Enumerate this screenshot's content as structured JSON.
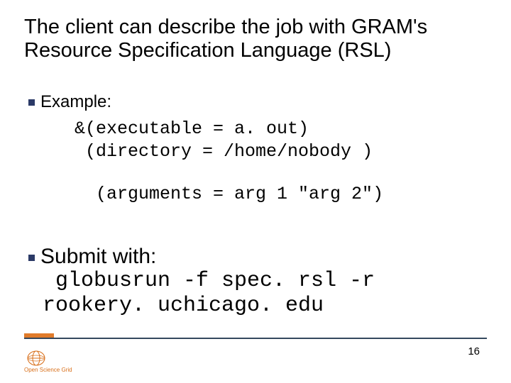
{
  "title": "The client can describe the job with GRAM's Resource Specification Language (RSL)",
  "bullets": {
    "example_label": "Example:",
    "code_line1": "&(executable = a. out)",
    "code_line2": " (directory = /home/nobody )",
    "code_line3": "(arguments = arg 1 \"arg 2\")",
    "submit_label": "Submit with:",
    "submit_code_line1": " globusrun -f spec. rsl -r",
    "submit_code_line2": "rookery. uchicago. edu"
  },
  "footer": {
    "logo_text": "Open Science Grid",
    "page_number": "16"
  }
}
